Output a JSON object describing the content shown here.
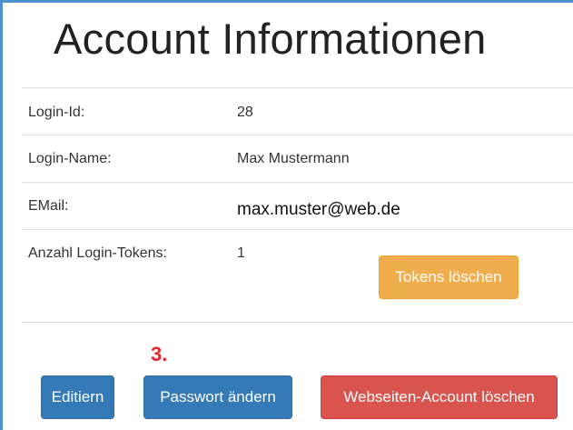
{
  "page": {
    "title": "Account Informationen"
  },
  "account": {
    "rows": [
      {
        "label": "Login-Id:",
        "value": "28"
      },
      {
        "label": "Login-Name:",
        "value": "Max Mustermann"
      },
      {
        "label": "EMail:",
        "value": "max.muster@web.de"
      },
      {
        "label": "Anzahl Login-Tokens:",
        "value": "1"
      }
    ]
  },
  "buttons": {
    "delete_tokens": "Tokens löschen",
    "edit": "Editiern",
    "change_password": "Passwort ändern",
    "delete_account": "Webseiten-Account löschen"
  },
  "annotation": {
    "step": "3."
  },
  "colors": {
    "frame": "#4d8fd1",
    "primary": "#337ab7",
    "warning": "#f0ad4e",
    "danger": "#d9534f",
    "step_marker": "#e8262e"
  }
}
